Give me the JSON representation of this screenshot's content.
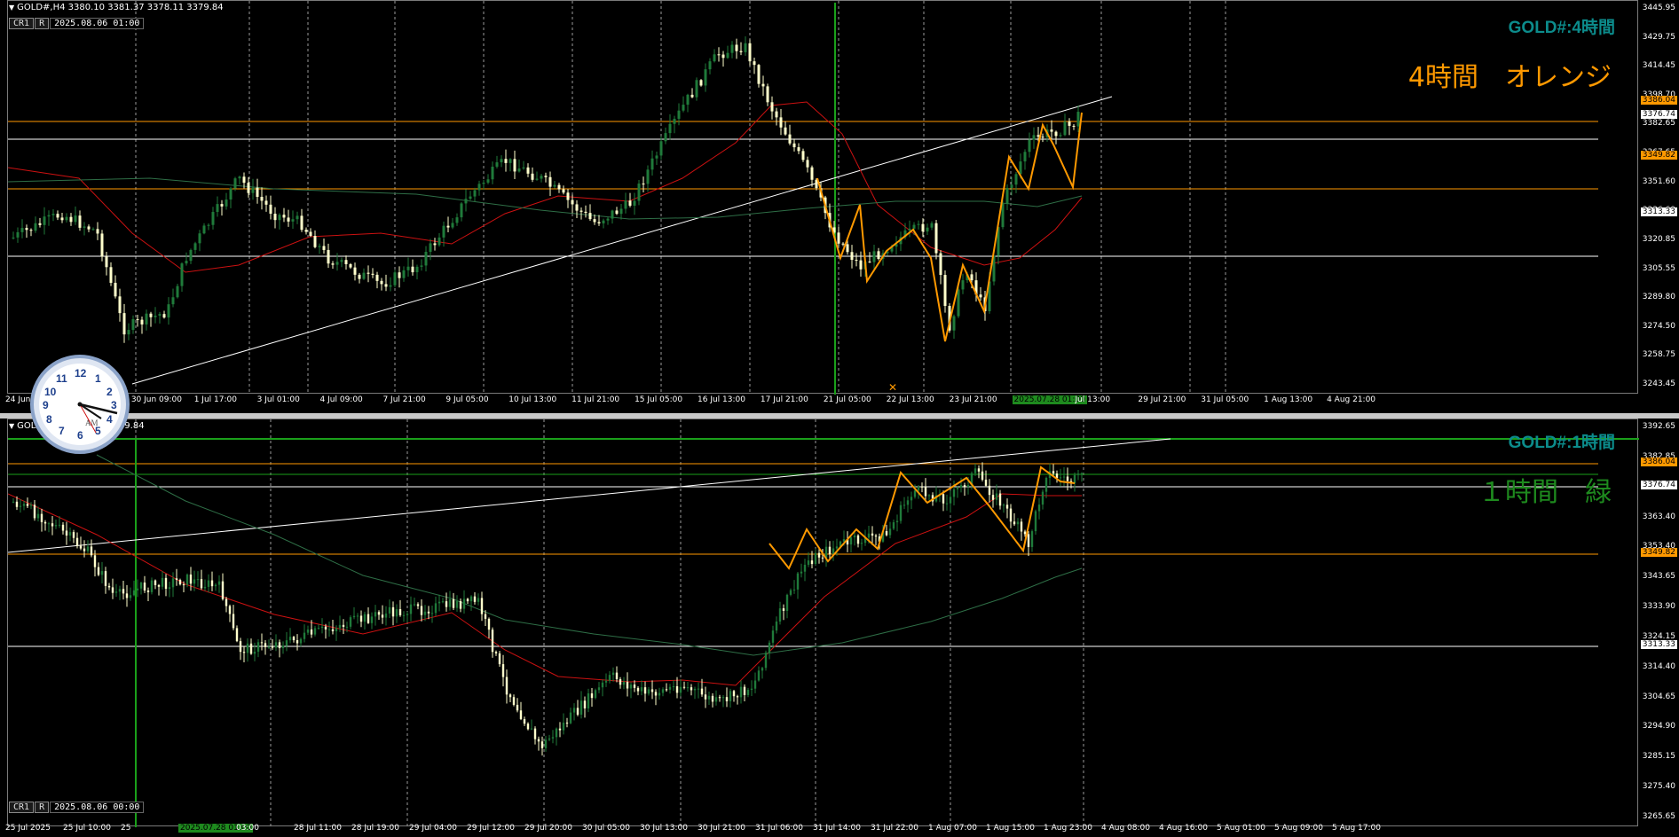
{
  "top": {
    "header": "GOLD#,H4  3380.10 3381.37 3378.11 3379.84",
    "cr1": "CR1",
    "r": "R",
    "datetime": "2025.08.06 01:00",
    "symbol_label": "GOLD#:4時間",
    "big_label": "4時間　オレンジ",
    "price_labels": [
      "3445.95",
      "3429.75",
      "3414.45",
      "3398.70",
      "3382.65",
      "3367.65",
      "3351.60",
      "3336.60",
      "3320.85",
      "3305.55",
      "3289.80",
      "3274.50",
      "3258.75",
      "3243.45"
    ],
    "tag_orange_high": "3386.04",
    "tag_white_1": "3376.74",
    "tag_orange_low": "3349.82",
    "tag_white_2": "3313.33",
    "time_labels": [
      "24 Jun 2025",
      "30 Jun 01:00",
      "30 Jun 09:00",
      "1 Jul 17:00",
      "3 Jul 01:00",
      "4 Jul 09:00",
      "7 Jul 21:00",
      "9 Jul 05:00",
      "10 Jul 13:00",
      "11 Jul 21:00",
      "15 Jul 05:00",
      "16 Jul 13:00",
      "17 Jul 21:00",
      "21 Jul 05:00",
      "22 Jul 13:00",
      "23 Jul 21:00",
      "2025.07.28 01:00",
      "Jul 13:00",
      "29 Jul 21:00",
      "31 Jul 05:00",
      "1 Aug 13:00",
      "4 Aug 21:00"
    ]
  },
  "bottom": {
    "header": "GOLD#,H1  3378.72 3379.84",
    "cr1": "CR1",
    "r": "R",
    "datetime": "2025.08.06 00:00",
    "symbol_label": "GOLD#:1時間",
    "big_label": "１時間　緑",
    "price_labels": [
      "3392.65",
      "3382.85",
      "3373.15",
      "3363.40",
      "3353.40",
      "3343.65",
      "3333.90",
      "3324.15",
      "3314.40",
      "3304.65",
      "3294.90",
      "3285.15",
      "3275.40",
      "3265.65"
    ],
    "tag_orange_high": "3386.04",
    "tag_white_1": "3376.74",
    "tag_orange_low": "3349.82",
    "tag_white_2": "3313.33",
    "time_labels": [
      "25 Jul 2025",
      "25 Jul 10:00",
      "25",
      "2025.07.28 01:00",
      "03:00",
      "28 Jul 11:00",
      "28 Jul 19:00",
      "29 Jul 04:00",
      "29 Jul 12:00",
      "29 Jul 20:00",
      "30 Jul 05:00",
      "30 Jul 13:00",
      "30 Jul 21:00",
      "31 Jul 06:00",
      "31 Jul 14:00",
      "31 Jul 22:00",
      "1 Aug 07:00",
      "1 Aug 15:00",
      "1 Aug 23:00",
      "4 Aug 08:00",
      "4 Aug 16:00",
      "5 Aug 01:00",
      "5 Aug 09:00",
      "5 Aug 17:00"
    ]
  },
  "clock": {
    "numbers": [
      "12",
      "1",
      "2",
      "3",
      "4",
      "5",
      "6",
      "7",
      "8",
      "9",
      "10",
      "11"
    ],
    "ampm": "AM"
  },
  "colors": {
    "background": "#000000",
    "bull_candle": "#1f7a3a",
    "bear_candle": "#ffffcc",
    "orange": "#ff9900",
    "ma_red": "#cc1111",
    "ma_green": "#2e6e46",
    "vline_green": "#1aa01a",
    "label_teal": "#0c8c8c",
    "label_green": "#1e8a1e"
  }
}
